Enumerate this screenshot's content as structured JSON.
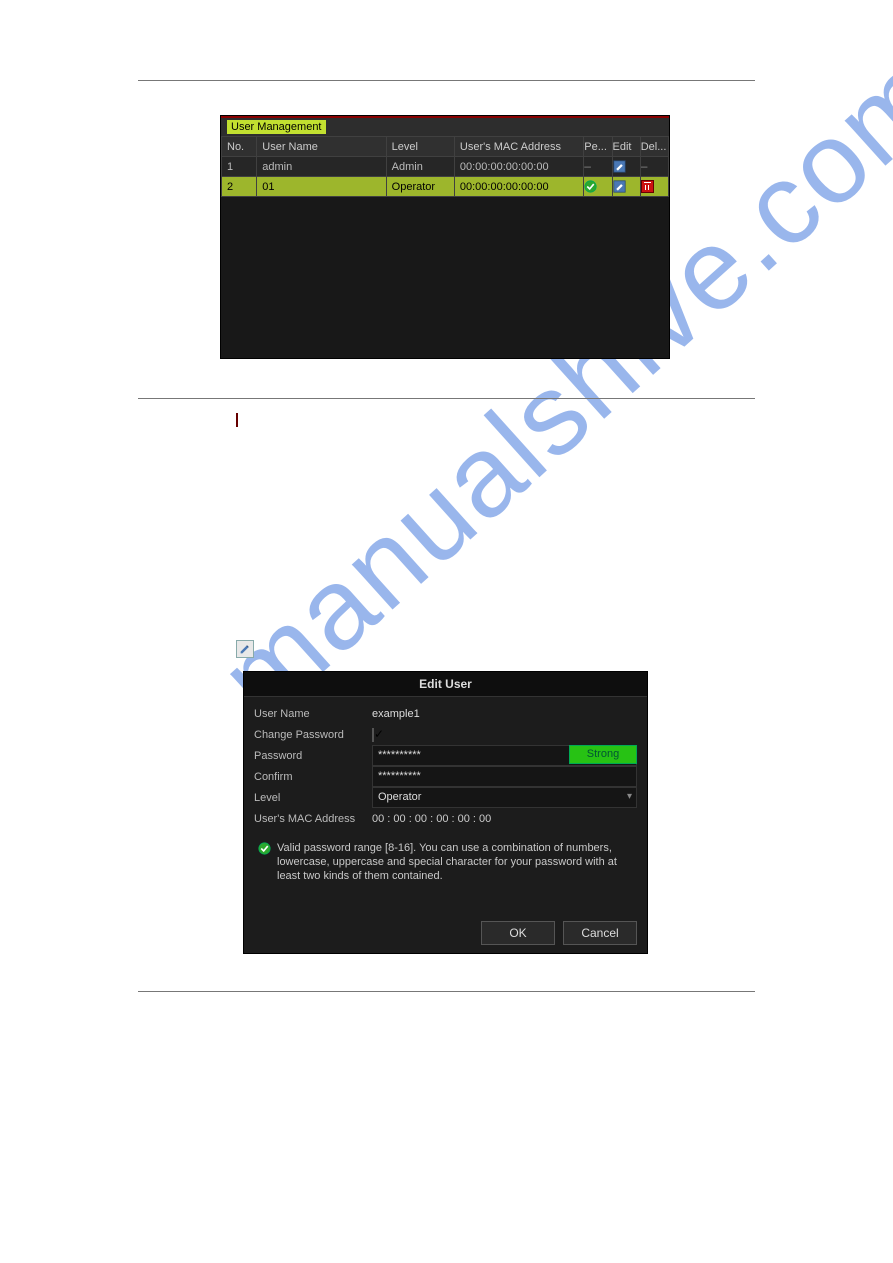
{
  "watermark": "manualshive.com",
  "fig1": {
    "title": "User Management",
    "headers": [
      "No.",
      "User Name",
      "Level",
      "User's MAC Address",
      "Pe...",
      "Edit",
      "Del..."
    ],
    "rows": [
      {
        "no": "1",
        "user": "admin",
        "level": "Admin",
        "mac": "00:00:00:00:00:00"
      },
      {
        "no": "2",
        "user": "01",
        "level": "Operator",
        "mac": "00:00:00:00:00:00"
      }
    ]
  },
  "fig2": {
    "title": "Edit User",
    "fields": {
      "username": {
        "label": "User Name",
        "value": "example1"
      },
      "change_password": {
        "label": "Change Password",
        "checked": true
      },
      "password": {
        "label": "Password",
        "value": "**********",
        "strength": "Strong"
      },
      "confirm": {
        "label": "Confirm",
        "value": "**********"
      },
      "level": {
        "label": "Level",
        "value": "Operator"
      },
      "mac": {
        "label": "User's MAC Address",
        "value": "00  : 00  : 00  : 00  : 00  : 00"
      }
    },
    "hint": "Valid password range [8-16]. You can use a combination of numbers, lowercase, uppercase and special character for your password with at least two kinds of them contained.",
    "buttons": {
      "ok": "OK",
      "cancel": "Cancel"
    }
  }
}
